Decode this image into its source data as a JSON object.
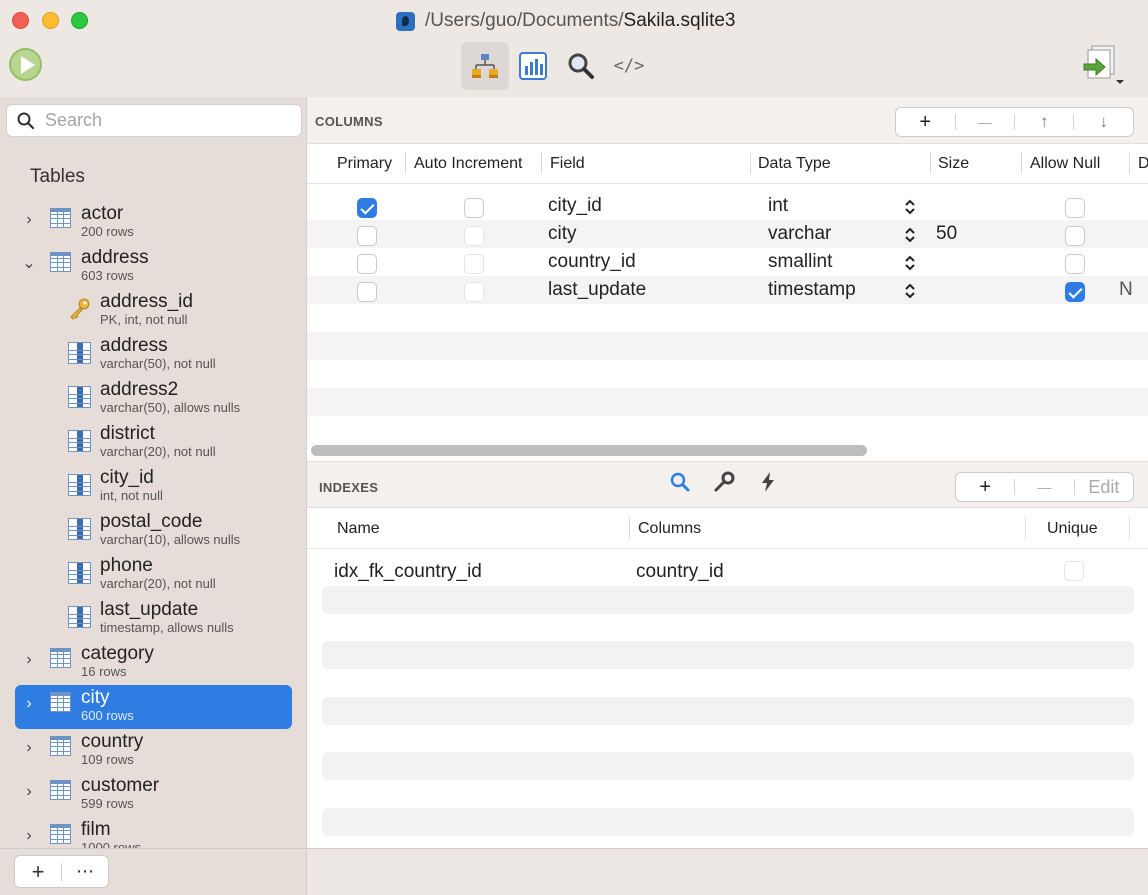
{
  "window": {
    "title_path": "/Users/guo/Documents/",
    "title_file": "Sakila.sqlite3"
  },
  "toolbar": {
    "tabs": [
      "structure",
      "chart",
      "query",
      "sql"
    ],
    "sql_label": "</>",
    "active_tab": "structure"
  },
  "sidebar": {
    "search_placeholder": "Search",
    "section_title": "Tables",
    "tables": [
      {
        "name": "actor",
        "sub": "200 rows",
        "expanded": false
      },
      {
        "name": "address",
        "sub": "603 rows",
        "expanded": true
      },
      {
        "name": "category",
        "sub": "16 rows",
        "expanded": false
      },
      {
        "name": "city",
        "sub": "600 rows",
        "expanded": false,
        "selected": true
      },
      {
        "name": "country",
        "sub": "109 rows",
        "expanded": false
      },
      {
        "name": "customer",
        "sub": "599 rows",
        "expanded": false
      },
      {
        "name": "film",
        "sub": "1000 rows",
        "expanded": false
      }
    ],
    "address_columns": [
      {
        "name": "address_id",
        "sub": "PK, int, not null",
        "icon": "key-icon"
      },
      {
        "name": "address",
        "sub": "varchar(50), not null",
        "icon": "column-icon"
      },
      {
        "name": "address2",
        "sub": "varchar(50), allows nulls",
        "icon": "column-icon"
      },
      {
        "name": "district",
        "sub": "varchar(20), not null",
        "icon": "column-icon"
      },
      {
        "name": "city_id",
        "sub": "int, not null",
        "icon": "column-icon"
      },
      {
        "name": "postal_code",
        "sub": "varchar(10), allows nulls",
        "icon": "column-icon"
      },
      {
        "name": "phone",
        "sub": "varchar(20), not null",
        "icon": "column-icon"
      },
      {
        "name": "last_update",
        "sub": "timestamp, allows nulls",
        "icon": "column-icon"
      }
    ],
    "footer": {
      "add": "+",
      "more": "⋯"
    }
  },
  "columns": {
    "title": "COLUMNS",
    "buttons": {
      "add": "+",
      "remove": "—",
      "up": "↑",
      "down": "↓"
    },
    "headers": [
      "Primary",
      "Auto Increment",
      "Field",
      "Data Type",
      "Size",
      "Allow Null",
      "D"
    ],
    "rows": [
      {
        "primary": true,
        "auto": false,
        "field": "city_id",
        "type": "int",
        "size": "",
        "null": false,
        "default": ""
      },
      {
        "primary": false,
        "auto": false,
        "field": "city",
        "type": "varchar",
        "size": "50",
        "null": false,
        "default": ""
      },
      {
        "primary": false,
        "auto": false,
        "field": "country_id",
        "type": "smallint",
        "size": "",
        "null": false,
        "default": ""
      },
      {
        "primary": false,
        "auto": false,
        "field": "last_update",
        "type": "timestamp",
        "size": "",
        "null": true,
        "default": "N"
      }
    ]
  },
  "indexes": {
    "title": "INDEXES",
    "buttons": {
      "add": "+",
      "remove": "—",
      "edit": "Edit"
    },
    "headers": [
      "Name",
      "Columns",
      "Unique"
    ],
    "rows": [
      {
        "name": "idx_fk_country_id",
        "columns": "country_id",
        "unique": false
      }
    ]
  }
}
